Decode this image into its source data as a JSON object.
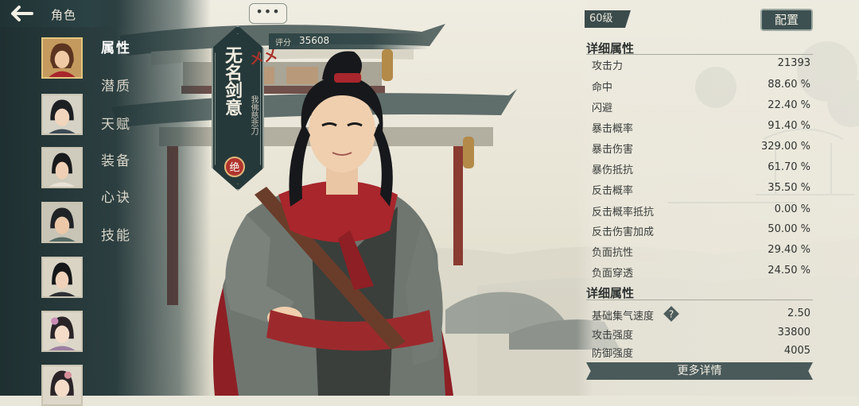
{
  "header": {
    "back_icon": "back-arrow-icon",
    "title": "角色"
  },
  "roster": [
    {
      "name": "avatar-1",
      "active": true
    },
    {
      "name": "avatar-2",
      "active": false
    },
    {
      "name": "avatar-3",
      "active": false
    },
    {
      "name": "avatar-4",
      "active": false
    },
    {
      "name": "avatar-5",
      "active": false
    },
    {
      "name": "avatar-6",
      "active": false
    },
    {
      "name": "avatar-7",
      "active": false
    }
  ],
  "menu": {
    "items": [
      {
        "label": "属性",
        "active": true
      },
      {
        "label": "潜质",
        "active": false
      },
      {
        "label": "天赋",
        "active": false
      },
      {
        "label": "装备",
        "active": false
      },
      {
        "label": "心诀",
        "active": false
      },
      {
        "label": "技能",
        "active": false
      }
    ]
  },
  "chat": {
    "label": "•••"
  },
  "character": {
    "title": "无名剑意",
    "subtitle": "我佛慈悲刀",
    "badge": "绝",
    "mark": "メメ"
  },
  "score": {
    "label": "评分",
    "value": "35608"
  },
  "level": "60级",
  "config_label": "配置",
  "sections": [
    {
      "title": "详细属性",
      "stats": [
        {
          "name": "攻击力",
          "value": "21393"
        },
        {
          "name": "命中",
          "value": "88.60 %"
        },
        {
          "name": "闪避",
          "value": "22.40 %"
        },
        {
          "name": "暴击概率",
          "value": "91.40 %"
        },
        {
          "name": "暴击伤害",
          "value": "329.00 %"
        },
        {
          "name": "暴伤抵抗",
          "value": "61.70 %"
        },
        {
          "name": "反击概率",
          "value": "35.50 %"
        },
        {
          "name": "反击概率抵抗",
          "value": "0.00 %"
        },
        {
          "name": "反击伤害加成",
          "value": "50.00 %"
        },
        {
          "name": "负面抗性",
          "value": "29.40 %"
        },
        {
          "name": "负面穿透",
          "value": "24.50 %"
        }
      ]
    },
    {
      "title": "详细属性",
      "stats": [
        {
          "name": "基础集气速度",
          "value": "2.50"
        },
        {
          "name": "攻击强度",
          "value": "33800"
        },
        {
          "name": "防御强度",
          "value": "4005"
        }
      ]
    }
  ],
  "more_label": "更多详情",
  "colors": {
    "panel_dark": "#26393a",
    "accent_gold": "#e2c77e",
    "scarf_red": "#a8262c",
    "badge_red": "#b0342d"
  }
}
